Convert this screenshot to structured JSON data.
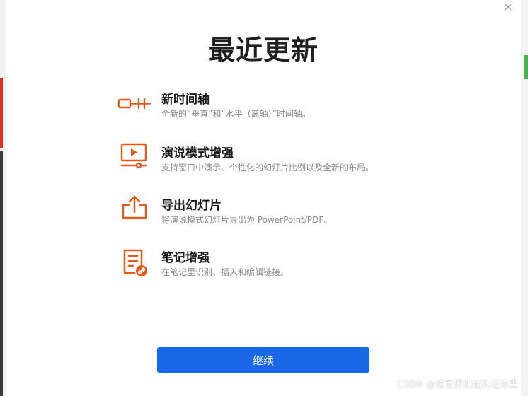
{
  "dialog": {
    "title": "最近更新",
    "close_glyph": "×",
    "continue_label": "继续",
    "accent_color": "#e8581c",
    "button_color": "#1968e5"
  },
  "features": [
    {
      "icon": "timeline-icon",
      "name": "新时间轴",
      "desc": "全新的“垂直”和“水平（离轴）”时间轴。"
    },
    {
      "icon": "presentation-icon",
      "name": "演说模式增强",
      "desc": "支持窗口中演示、个性化的幻灯片比例以及全新的布局。"
    },
    {
      "icon": "export-icon",
      "name": "导出幻灯片",
      "desc": "将演说模式幻灯片导出为 PowerPoint/PDF。"
    },
    {
      "icon": "note-link-icon",
      "name": "笔记增强",
      "desc": "在笔记里识别、插入和编辑链接。"
    }
  ],
  "watermark": "CSDN @这世界比瞳孔还漆黑"
}
